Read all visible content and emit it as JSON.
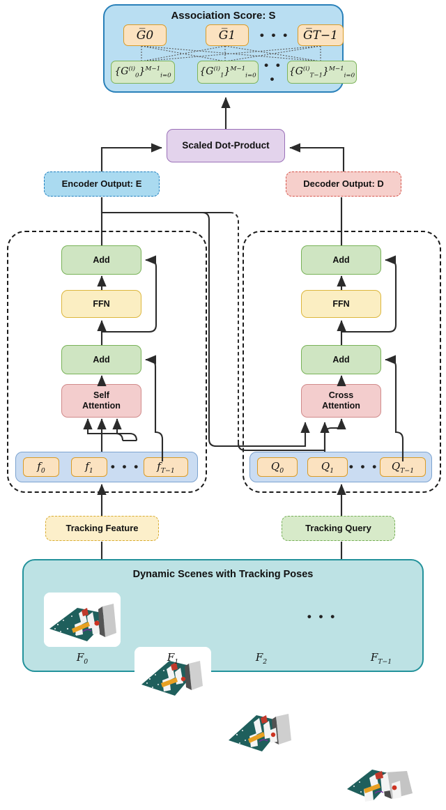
{
  "association": {
    "title": "Association Score: S",
    "ghat": [
      "G̅0",
      "G̅1",
      "G̅T−1"
    ],
    "ghat_tex": [
      {
        "base": "G",
        "hat": true,
        "sub": "0"
      },
      {
        "base": "G",
        "hat": true,
        "sub": "1"
      },
      {
        "base": "G",
        "hat": true,
        "sub": "T−1"
      }
    ],
    "gsets": [
      {
        "prefix": "{G",
        "sub": "0",
        "sup": "(i)",
        "close": "}",
        "upper": "M−1",
        "lower": "i=0"
      },
      {
        "prefix": "{G",
        "sub": "1",
        "sup": "(i)",
        "close": "}",
        "upper": "M−1",
        "lower": "i=0"
      },
      {
        "prefix": "{G",
        "sub": "T−1",
        "sup": "(i)",
        "close": "}",
        "upper": "M−1",
        "lower": "i=0"
      }
    ],
    "ellipsis": "• • •"
  },
  "scaled_dot_product": {
    "label": "Scaled Dot-Product"
  },
  "encoder_output": {
    "label": "Encoder Output: E"
  },
  "decoder_output": {
    "label": "Decoder Output: D"
  },
  "encoder": {
    "add_top": "Add",
    "ffn": "FFN",
    "add_bottom": "Add",
    "attention_line1": "Self",
    "attention_line2": "Attention",
    "tokens": [
      {
        "base": "f",
        "sub": "0"
      },
      {
        "base": "f",
        "sub": "1"
      },
      {
        "base": "f",
        "sub": "T−1"
      }
    ],
    "tokens_ellipsis": "• • •",
    "source": "Tracking Feature"
  },
  "decoder": {
    "add_top": "Add",
    "ffn": "FFN",
    "add_bottom": "Add",
    "attention_line1": "Cross",
    "attention_line2": "Attention",
    "tokens": [
      {
        "base": "Q",
        "sub": "0"
      },
      {
        "base": "Q",
        "sub": "1"
      },
      {
        "base": "Q",
        "sub": "T−1"
      }
    ],
    "tokens_ellipsis": "• • •",
    "source": "Tracking Query"
  },
  "scenes": {
    "title": "Dynamic Scenes with Tracking Poses",
    "ellipsis": "• • •",
    "frames": [
      {
        "base": "F",
        "sub": "0"
      },
      {
        "base": "F",
        "sub": "1"
      },
      {
        "base": "F",
        "sub": "2"
      },
      {
        "base": "F",
        "sub": "T−1"
      }
    ]
  },
  "colors": {
    "panel_blue_fill": "#b9def2",
    "panel_blue_border": "#2980b9",
    "orange_fill": "#fbe2c0",
    "orange_border": "#d99b27",
    "green_fill": "#d7e9c8",
    "green_border": "#7cb35a",
    "purple_fill": "#e3d3ec",
    "purple_border": "#9a70b8",
    "red_fill": "#f3cdcd",
    "red_border": "#d08a8a",
    "yellow_fill": "#fbeec2",
    "yellow_border": "#dcb63c",
    "strip_blue": "#cadcf2",
    "teal_fill": "#bde2e4",
    "teal_border": "#23929b",
    "arrow": "#2b2b2b",
    "scene_ground": "#1f5f5c"
  }
}
